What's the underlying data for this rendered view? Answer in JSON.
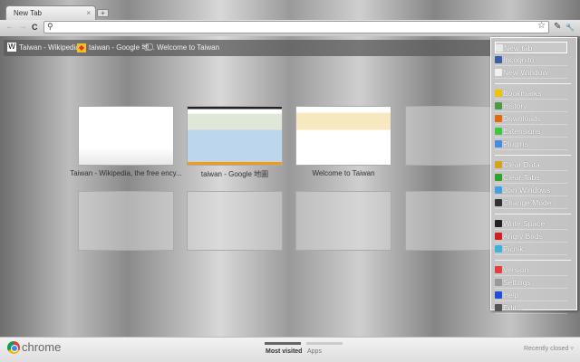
{
  "tab": {
    "title": "New Tab",
    "close": "×",
    "new": "+"
  },
  "toolbar": {
    "back": "←",
    "forward": "→",
    "reload": "C",
    "search_icon": "⚲",
    "star": "☆",
    "page": "✎",
    "wrench": "🔧"
  },
  "bookmarks": [
    {
      "icon": "W",
      "label": "Taiwan - Wikipedia..."
    },
    {
      "icon": "◆",
      "label": "taiwan - Google 地..."
    },
    {
      "icon": "◯",
      "label": "Welcome to Taiwan"
    }
  ],
  "thumbnails": [
    {
      "caption": "Taiwan - Wikipedia, the free ency..."
    },
    {
      "caption": "taiwan - Google 地圖"
    },
    {
      "caption": "Welcome to Taiwan"
    }
  ],
  "menu": [
    {
      "label": "New tab",
      "color": "#e8e8e8"
    },
    {
      "label": "Incognito",
      "color": "#3a5fa8"
    },
    {
      "label": "New Window",
      "color": "#f0f0f0"
    },
    {
      "label": "Bookmarks",
      "color": "#f2c200"
    },
    {
      "label": "History",
      "color": "#4a9a4a"
    },
    {
      "label": "Downloads",
      "color": "#e06a10"
    },
    {
      "label": "Extensions",
      "color": "#3cc83c"
    },
    {
      "label": "Plugins",
      "color": "#4a8ae0"
    },
    {
      "label": "Clear Data",
      "color": "#d8a020"
    },
    {
      "label": "Clear Tabs",
      "color": "#30a030"
    },
    {
      "label": "Join Windows",
      "color": "#40a0e0"
    },
    {
      "label": "Change Mode",
      "color": "#333333"
    },
    {
      "label": "Write Space",
      "color": "#222222"
    },
    {
      "label": "Angry Birds",
      "color": "#d02020"
    },
    {
      "label": "Picnik",
      "color": "#40b0e0"
    },
    {
      "label": "Version",
      "color": "#e04040"
    },
    {
      "label": "Settings",
      "color": "#999999"
    },
    {
      "label": "Help",
      "color": "#2050d0"
    },
    {
      "label": "Edit...",
      "color": "#555555"
    }
  ],
  "footer": {
    "brand": "chrome",
    "tabs": [
      "Most visited",
      "Apps"
    ],
    "recent": "Recently closed ▿"
  }
}
